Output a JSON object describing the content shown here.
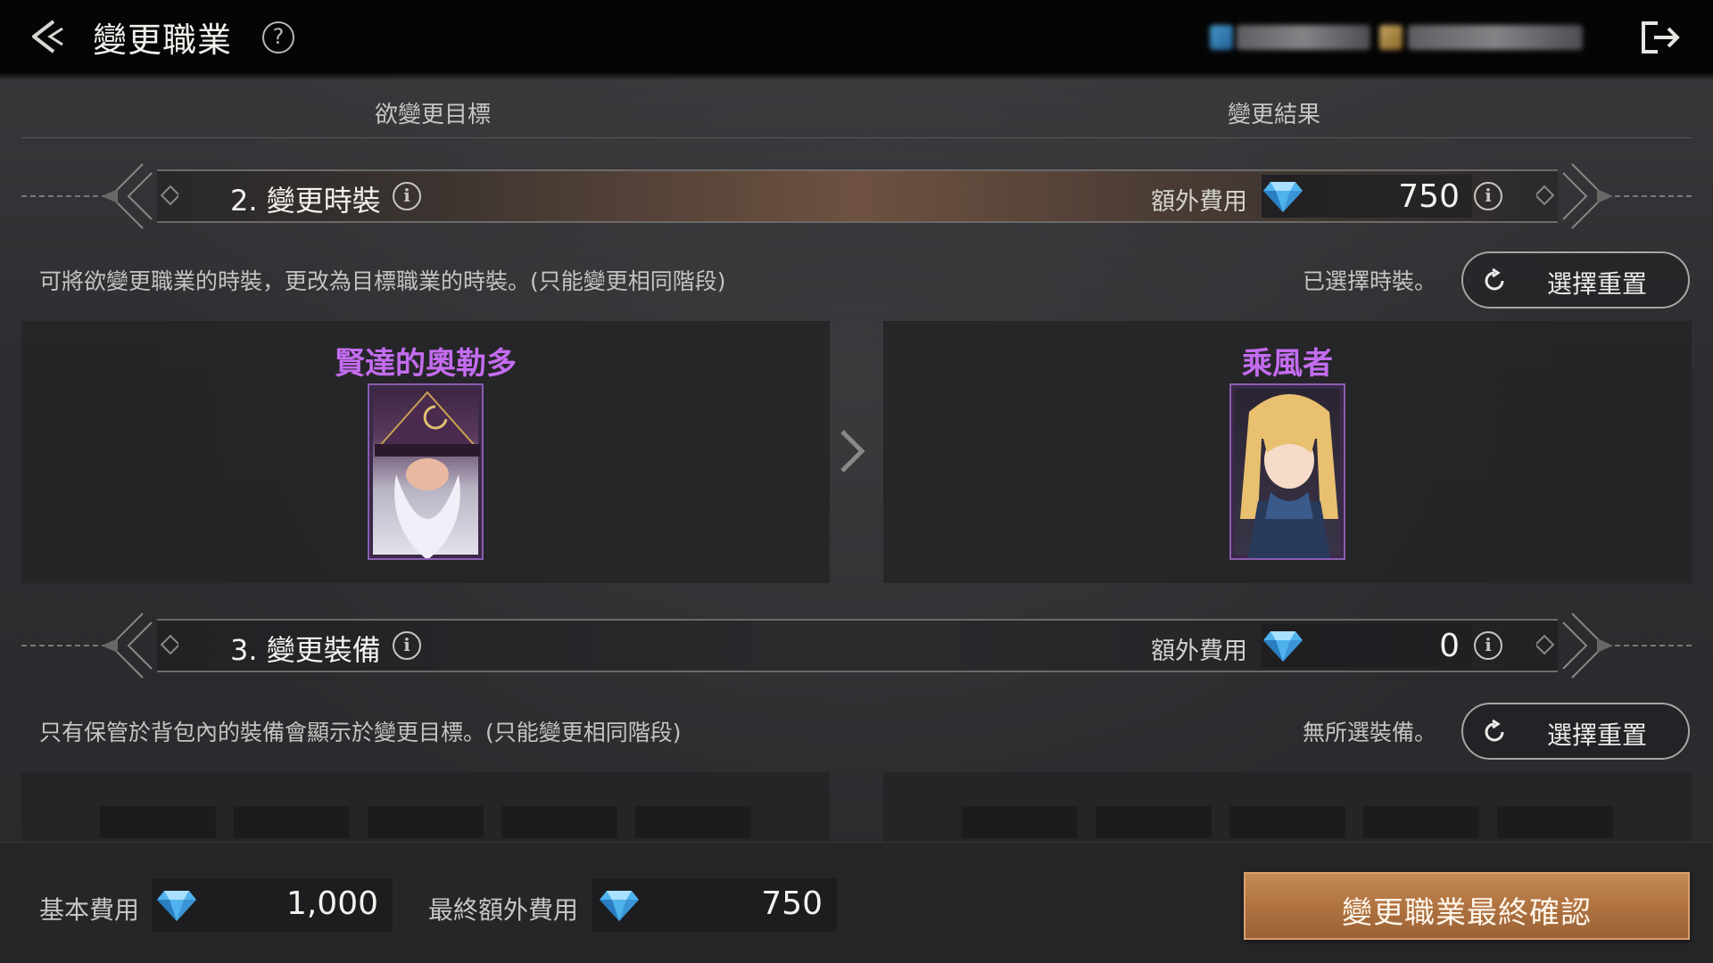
{
  "header": {
    "title": "變更職業",
    "back_icon": "back-arrow-icon",
    "help_icon": "question-icon",
    "help_glyph": "?",
    "exit_icon": "exit-icon"
  },
  "columns": {
    "left": "欲變更目標",
    "right": "變更結果"
  },
  "costume_section": {
    "title": "2. 變更時裝",
    "info_glyph": "i",
    "extra_label": "額外費用",
    "extra_value": "750",
    "description": "可將欲變更職業的時裝，更改為目標職業的時裝。(只能變更相同階段)",
    "status": "已選擇時裝。",
    "reset_label": "選擇重置",
    "source_name": "賢達的奧勒多",
    "target_name": "乘風者",
    "name_color": "#c46cf0"
  },
  "equipment_section": {
    "title": "3. 變更裝備",
    "info_glyph": "i",
    "extra_label": "額外費用",
    "extra_value": "0",
    "description": "只有保管於背包內的裝備會顯示於變更目標。(只能變更相同階段)",
    "status": "無所選裝備。",
    "reset_label": "選擇重置"
  },
  "footer": {
    "base_label": "基本費用",
    "base_value": "1,000",
    "final_label": "最終額外費用",
    "final_value": "750",
    "confirm_label": "變更職業最終確認",
    "currency_icon": "diamond-gem-icon"
  },
  "colors": {
    "accent": "#b07341",
    "gem": "#4fb2ec",
    "text": "#d8d6d2"
  }
}
